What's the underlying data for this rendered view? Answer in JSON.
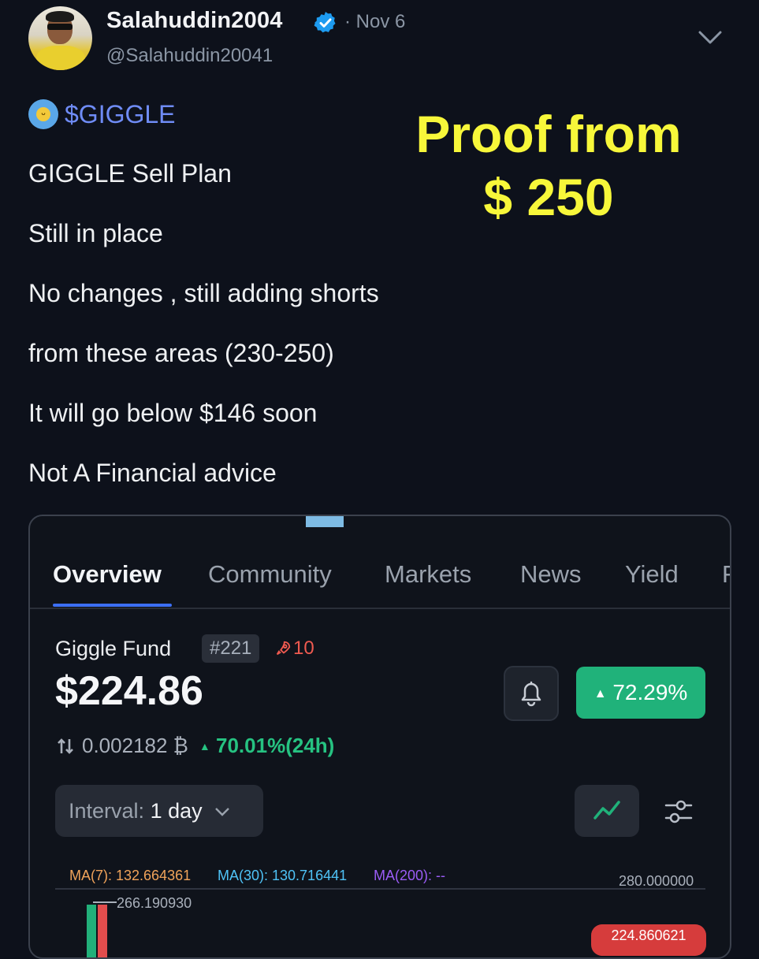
{
  "tweet": {
    "display_name": "Salahuddin2004",
    "handle": "@Salahuddin20041",
    "date": "· Nov 6",
    "ticker": "$GIGGLE",
    "lines": [
      "GIGGLE Sell Plan",
      "Still in place",
      "No changes , still adding shorts",
      "from these areas (230-250)",
      "It will go below $146 soon",
      "Not A Financial advice"
    ],
    "overlay_line1": "Proof from",
    "overlay_line2": "$ 250",
    "colors": {
      "accent": "#f7f73a",
      "ticker": "#6f8cf6",
      "verified": "#1d9bf0"
    }
  },
  "embed": {
    "tabs": [
      "Overview",
      "Community",
      "Markets",
      "News",
      "Yield",
      "F"
    ],
    "active_tab": "Overview",
    "coin_name": "Giggle Fund",
    "rank": "#221",
    "rocket_count": "10",
    "price": "$224.86",
    "change_pill": "72.29%",
    "btc_price": "0.002182 ₿",
    "change_24h": "70.01%(24h)",
    "interval_label": "Interval:",
    "interval_value": "1 day",
    "ma7": "MA(7): 132.664361",
    "ma30": "MA(30): 130.716441",
    "ma200": "MA(200): --",
    "axis_top": "280.000000",
    "high_label": "266.190930",
    "current_tag": "224.860621",
    "colors": {
      "up": "#20b27a",
      "down": "#d63c3c",
      "ma7": "#f0a35a",
      "ma30": "#4fc3f7",
      "ma200": "#9b5cf6",
      "tab_underline": "#3c6ff5"
    }
  }
}
